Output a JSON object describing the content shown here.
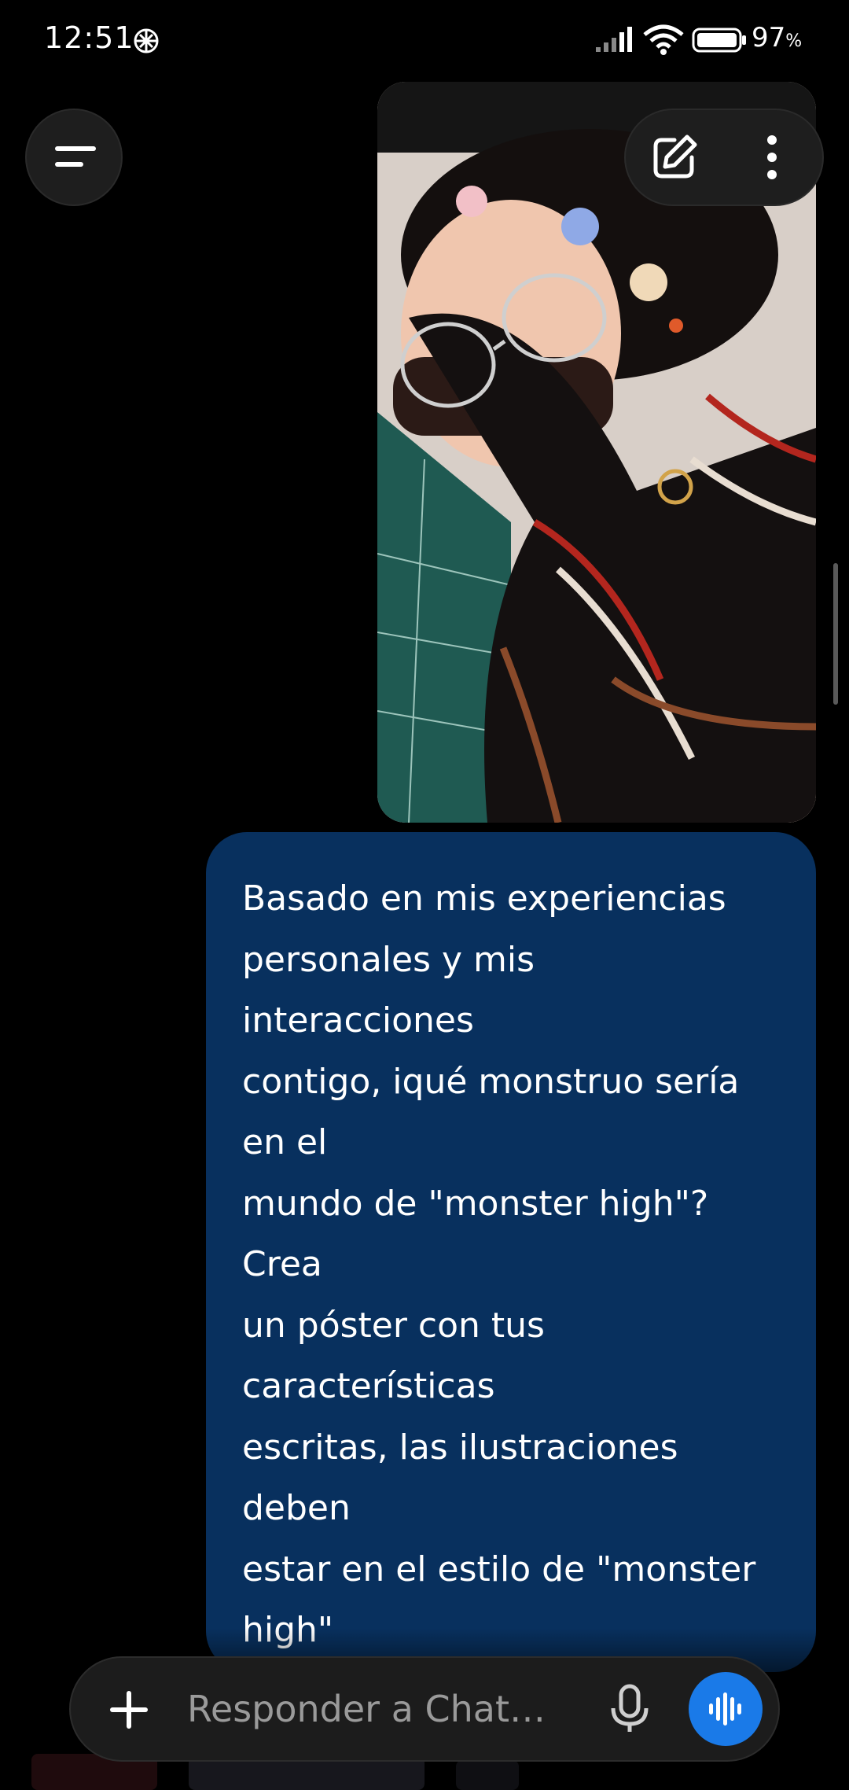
{
  "status_bar": {
    "time": "12:51",
    "app_icon": "openai-logo-icon",
    "battery_level": "97",
    "battery_unit": "%",
    "icons": [
      "signal-icon",
      "wifi-icon",
      "battery-icon"
    ]
  },
  "header": {
    "menu_icon": "menu-icon",
    "edit_icon": "edit-icon",
    "more_icon": "more-vertical-icon"
  },
  "message": {
    "image_alt": "user-photo",
    "lines": [
      "Basado en mis experiencias",
      "personales y mis",
      "interacciones",
      "contigo, iqué monstruo sería",
      "en el",
      "mundo de \"monster high\"?",
      "Crea",
      "un póster con tus",
      "características",
      "escritas, las ilustraciones",
      "deben",
      "estar en el estilo de \"monster",
      "high\""
    ]
  },
  "composer": {
    "placeholder": "Responder a Chat…",
    "plus_icon": "plus-icon",
    "mic_icon": "mic-icon",
    "voice_icon": "voice-waveform-icon"
  },
  "colors": {
    "background": "#000000",
    "bubble": "#08305e",
    "accent": "#1a7ae8",
    "pill": "#1e1e1e"
  }
}
